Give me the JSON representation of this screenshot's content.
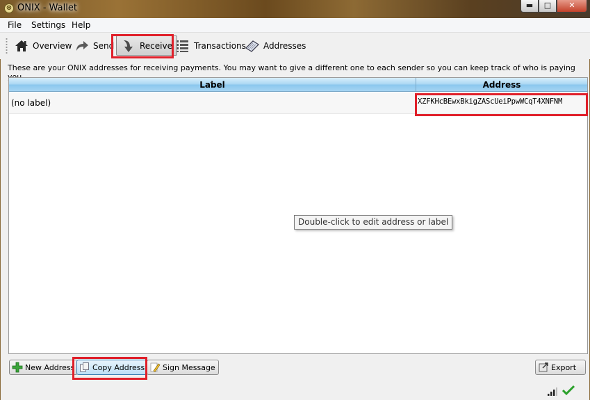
{
  "window": {
    "title": "ONIX - Wallet",
    "controls": {
      "minimize": "▬",
      "maximize": "□",
      "close": "✕"
    }
  },
  "menu": [
    {
      "label": "File"
    },
    {
      "label": "Settings"
    },
    {
      "label": "Help"
    }
  ],
  "toolbar": {
    "overview": "Overview",
    "send": "Send",
    "receive": "Receive",
    "transactions": "Transactions",
    "addresses": "Addresses",
    "active": "receive"
  },
  "receive_page": {
    "intro": "These are your ONIX addresses for receiving payments. You may want to give a different one to each sender so you can keep track of who is paying you.",
    "columns": {
      "label": "Label",
      "address": "Address"
    },
    "rows": [
      {
        "label": "(no label)",
        "address": "XZFKHcBEwxBkigZAScUeiPpwWCqT4XNFNM"
      }
    ],
    "tooltip": "Double-click to edit address or label",
    "buttons": {
      "new_address": "New Address",
      "copy_address": "Copy Address",
      "sign_message": "Sign Message",
      "export": "Export"
    }
  },
  "colors": {
    "highlight_box": "#e0202a",
    "header_blue": "#a8d6f2",
    "sync_check": "#2aa02a"
  }
}
